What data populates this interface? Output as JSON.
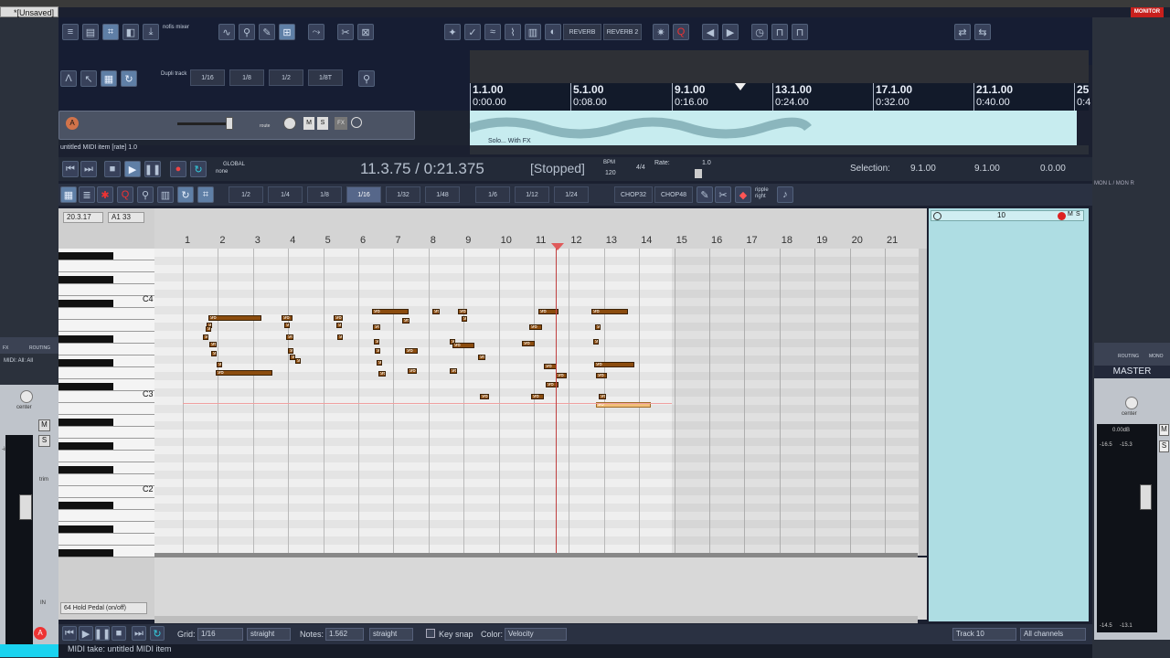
{
  "window": {
    "tab_title": "*[Unsaved]",
    "monitor_fx": "MONITOR FX"
  },
  "toolbar_main": {
    "mixer_label": "nofis mixer",
    "reverb_label": "REVERB",
    "reverb2_label": "REVERB 2"
  },
  "toolbar_midi": {
    "dupli_label": "Dupli track",
    "grid_top": [
      "1/16",
      "1/8",
      "1/2",
      "1/8T"
    ]
  },
  "ruler": {
    "marks": [
      {
        "bar": "1.1.00",
        "time": "0:00.00"
      },
      {
        "bar": "5.1.00",
        "time": "0:08.00"
      },
      {
        "bar": "9.1.00",
        "time": "0:16.00"
      },
      {
        "bar": "13.1.00",
        "time": "0:24.00"
      },
      {
        "bar": "17.1.00",
        "time": "0:32.00"
      },
      {
        "bar": "21.1.00",
        "time": "0:40.00"
      },
      {
        "bar": "25",
        "time": "0:4"
      }
    ]
  },
  "track": {
    "item_label": "untitled MIDI item [rate] 1.0",
    "m": "M",
    "s": "S",
    "fx": "FX",
    "route": "route",
    "audio_label": "Solo... With FX"
  },
  "transport": {
    "position": "11.3.75 / 0:21.375",
    "state": "[Stopped]",
    "bpm_label": "BPM",
    "bpm": "120",
    "sig": "4/4",
    "rate_label": "Rate:",
    "rate": "1.0",
    "selection_label": "Selection:",
    "sel_start": "9.1.00",
    "sel_end": "9.1.00",
    "sel_len": "0.0.00",
    "global_label": "GLOBAL",
    "global_value": "none"
  },
  "midi_toolbar": {
    "grids": [
      "1/2",
      "1/4",
      "1/8",
      "1/16",
      "1/32",
      "1/48",
      "1/6",
      "1/12",
      "1/24"
    ],
    "chop32": "CHOP32",
    "chop48": "CHOP48",
    "ripple": "ripple right"
  },
  "editor": {
    "pos_field": "20.3.17",
    "note_field": "A1 33",
    "octave_labels": [
      "C4",
      "C3",
      "C2"
    ],
    "bars": [
      "1",
      "2",
      "3",
      "4",
      "5",
      "6",
      "7",
      "8",
      "9",
      "10",
      "11",
      "12",
      "13",
      "14",
      "15",
      "16",
      "17",
      "18",
      "19",
      "20",
      "21"
    ],
    "velocity": "96",
    "cc_lane": "64 Hold Pedal (on/off)"
  },
  "bottom": {
    "grid_label": "Grid:",
    "grid_value": "1/16",
    "grid_mode": "straight",
    "notes_label": "Notes:",
    "notes_value": "1.562",
    "notes_mode": "straight",
    "keysnap": "Key snap",
    "color_label": "Color:",
    "color_value": "Velocity",
    "track_value": "Track 10",
    "channels_value": "All channels"
  },
  "status": "MIDI take: untitled MIDI item",
  "inspector": {
    "track_num": "10",
    "m": "M",
    "s": "S"
  },
  "master": {
    "label": "MASTER",
    "pan": "center",
    "gain": "0.00dB",
    "peak_l": "-16.5",
    "peak_r": "-15.3",
    "bottom_l": "-14.5",
    "bottom_r": "-13.1",
    "routing": "ROUTING",
    "mono": "MONO",
    "mon_label": "MON L / MON R",
    "m": "M",
    "s": "S"
  },
  "leftmixer": {
    "midi_label": "MIDI: All: All",
    "pan": "center",
    "m": "M",
    "s": "S",
    "trim": "trim",
    "inf": "-inf",
    "fx": "FX",
    "routing": "ROUTING",
    "in": "IN"
  }
}
